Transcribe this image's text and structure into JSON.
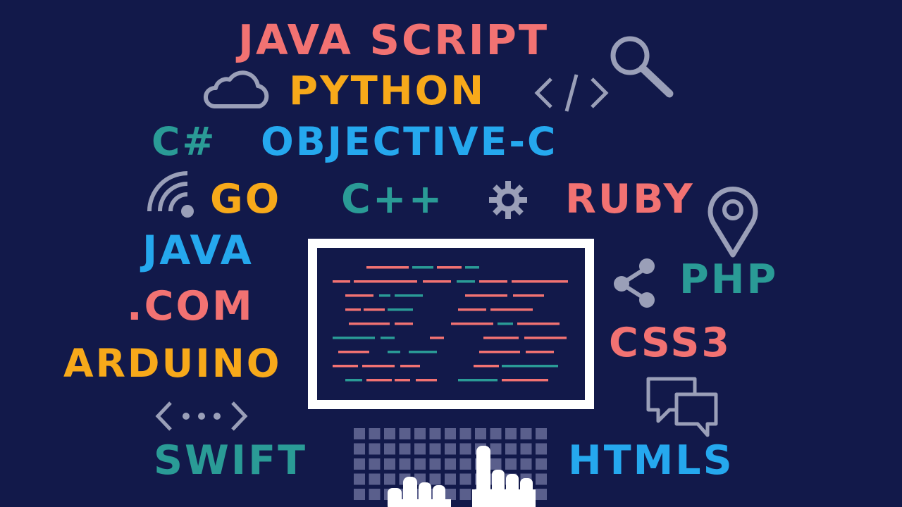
{
  "colors": {
    "background": "#12194a",
    "coral": "#f27272",
    "orange": "#f7a91a",
    "sky": "#25a8ee",
    "teal": "#2a9b96",
    "icon_gray": "#9a9fb8",
    "white": "#ffffff"
  },
  "words": {
    "javascript": "JAVA SCRIPT",
    "python": "PYTHON",
    "csharp": "C#",
    "objective_c": "OBJECTIVE-C",
    "go": "GO",
    "cpp": "C++",
    "ruby": "RUBY",
    "java": "JAVA",
    "dotcom": ".COM",
    "php": "PHP",
    "css3": "CSS3",
    "arduino": "ARDUINO",
    "swift": "SWIFT",
    "htmls": "HTMLS"
  },
  "icons": [
    "cloud-icon",
    "search-icon",
    "code-tag-icon",
    "wifi-icon",
    "gear-icon",
    "location-pin-icon",
    "share-icon",
    "chat-bubbles-icon",
    "ellipsis-code-icon",
    "monitor-icon",
    "keyboard-icon",
    "hand-pointer-icon"
  ]
}
